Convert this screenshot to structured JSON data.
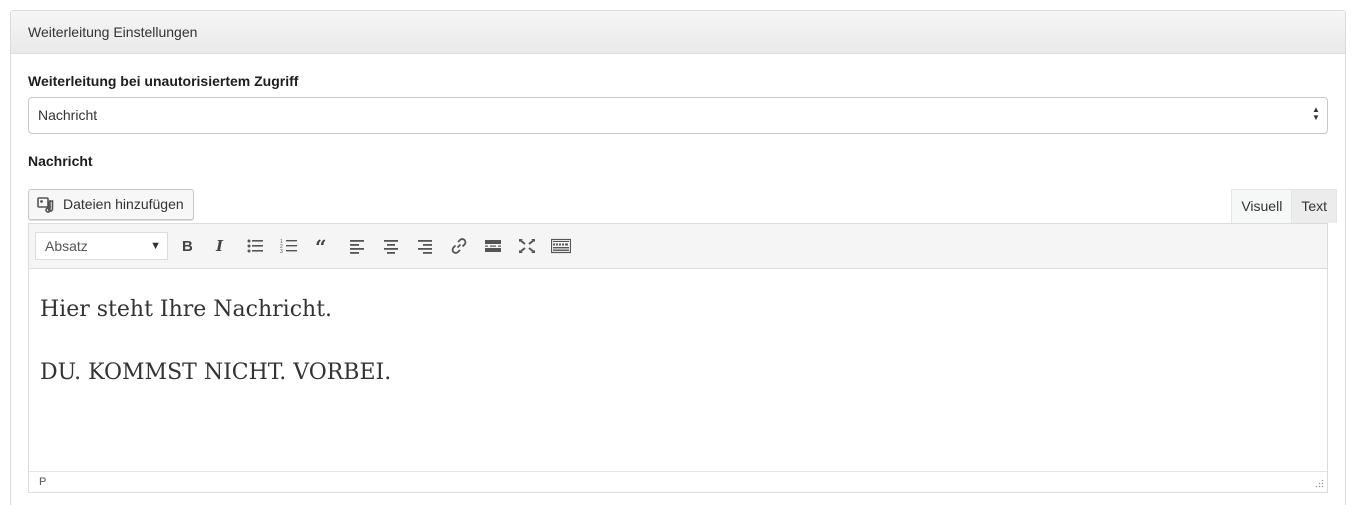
{
  "panel": {
    "title": "Weiterleitung Einstellungen"
  },
  "redirect": {
    "label": "Weiterleitung bei unautorisiertem Zugriff",
    "selected": "Nachricht"
  },
  "message": {
    "label": "Nachricht",
    "add_media_label": "Dateien hinzufügen",
    "tabs": {
      "visual": "Visuell",
      "text": "Text"
    },
    "toolbar": {
      "format": "Absatz",
      "buttons": [
        "bold-icon",
        "italic-icon",
        "bullet-list-icon",
        "numbered-list-icon",
        "blockquote-icon",
        "align-left-icon",
        "align-center-icon",
        "align-right-icon",
        "link-icon",
        "read-more-icon",
        "fullscreen-icon",
        "toolbar-toggle-icon"
      ]
    },
    "content": {
      "line1": "Hier steht Ihre Nachricht.",
      "line2": "DU. KOMMST NICHT. VORBEI."
    },
    "status_path": "P"
  }
}
